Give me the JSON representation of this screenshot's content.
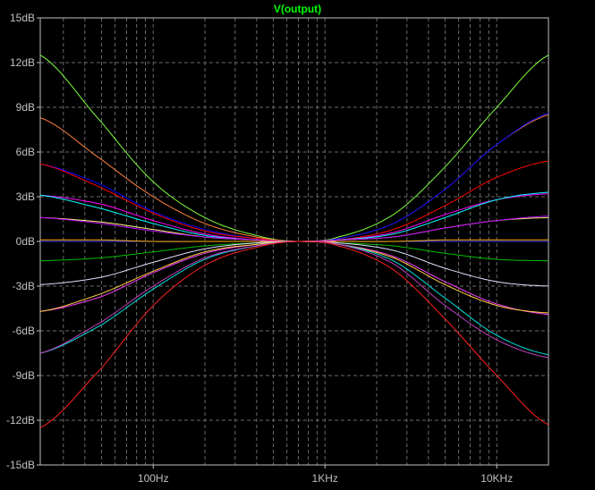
{
  "chart_data": {
    "type": "line",
    "title": "V(output)",
    "xlabel": "",
    "ylabel": "",
    "x_scale": "log",
    "xlim": [
      22,
      20000
    ],
    "ylim": [
      -15,
      15
    ],
    "grid": true,
    "y_ticks": [
      {
        "value": 15,
        "label": "15dB"
      },
      {
        "value": 12,
        "label": "12dB"
      },
      {
        "value": 9,
        "label": "9dB"
      },
      {
        "value": 6,
        "label": "6dB"
      },
      {
        "value": 3,
        "label": "3dB"
      },
      {
        "value": 0,
        "label": "0dB"
      },
      {
        "value": -3,
        "label": "-3dB"
      },
      {
        "value": -6,
        "label": "-6dB"
      },
      {
        "value": -9,
        "label": "-9dB"
      },
      {
        "value": -12,
        "label": "-12dB"
      },
      {
        "value": -15,
        "label": "-15dB"
      }
    ],
    "x_ticks": [
      {
        "value": 100,
        "label": "100Hz"
      },
      {
        "value": 1000,
        "label": "1KHz"
      },
      {
        "value": 10000,
        "label": "10KHz"
      }
    ],
    "series": [
      {
        "color": "#80ff40",
        "x": [
          22,
          50,
          100,
          200,
          400,
          700,
          1200,
          2500,
          5000,
          10000,
          20000
        ],
        "y": [
          12.5,
          8.0,
          4.0,
          1.6,
          0.4,
          0.0,
          0.3,
          1.8,
          5.0,
          9.0,
          12.5
        ]
      },
      {
        "color": "#ff8040",
        "x": [
          22,
          50,
          100,
          200,
          400,
          700,
          1200,
          2500,
          5000,
          10000,
          20000
        ],
        "y": [
          8.3,
          5.5,
          3.0,
          1.2,
          0.3,
          0.0,
          0.2,
          1.2,
          3.5,
          6.5,
          8.5
        ]
      },
      {
        "color": "#0000ff",
        "x": [
          22,
          50,
          100,
          200,
          400,
          700,
          1200,
          2500,
          5000,
          10000,
          20000
        ],
        "y": [
          5.2,
          3.8,
          2.0,
          0.8,
          0.2,
          0.0,
          0.2,
          1.2,
          3.5,
          6.5,
          8.6
        ]
      },
      {
        "color": "#ff0000",
        "x": [
          22,
          50,
          100,
          200,
          400,
          700,
          1200,
          2500,
          5000,
          10000,
          20000
        ],
        "y": [
          5.2,
          3.6,
          1.9,
          0.7,
          0.2,
          0.0,
          0.1,
          0.8,
          2.4,
          4.3,
          5.4
        ]
      },
      {
        "color": "#ff00ff",
        "x": [
          22,
          50,
          100,
          200,
          400,
          700,
          1200,
          2500,
          5000,
          10000,
          20000
        ],
        "y": [
          3.1,
          2.5,
          1.4,
          0.5,
          0.1,
          0.0,
          0.1,
          0.6,
          1.8,
          2.8,
          3.2
        ]
      },
      {
        "color": "#00ffff",
        "x": [
          22,
          50,
          100,
          200,
          400,
          700,
          1200,
          2500,
          5000,
          10000,
          20000
        ],
        "y": [
          3.1,
          2.2,
          1.2,
          0.4,
          0.1,
          0.0,
          0.1,
          0.5,
          1.6,
          2.8,
          3.3
        ]
      },
      {
        "color": "#ffff80",
        "x": [
          22,
          50,
          100,
          200,
          400,
          700,
          1200,
          2500,
          5000,
          10000,
          20000
        ],
        "y": [
          1.6,
          1.3,
          0.8,
          0.3,
          0.1,
          0.0,
          0.1,
          0.3,
          0.9,
          1.4,
          1.6
        ]
      },
      {
        "color": "#c000ff",
        "x": [
          22,
          50,
          100,
          200,
          400,
          700,
          1200,
          2500,
          5000,
          10000,
          20000
        ],
        "y": [
          1.6,
          1.2,
          0.7,
          0.3,
          0.1,
          0.0,
          0.1,
          0.3,
          0.9,
          1.4,
          1.7
        ]
      },
      {
        "color": "#4040ff",
        "x": [
          22,
          50,
          100,
          200,
          400,
          700,
          1200,
          2500,
          5000,
          10000,
          20000
        ],
        "y": [
          0.0,
          0.0,
          0.0,
          0.0,
          0.0,
          0.0,
          0.0,
          0.0,
          0.0,
          0.0,
          0.0
        ]
      },
      {
        "color": "#ffb000",
        "x": [
          22,
          50,
          100,
          200,
          400,
          700,
          1200,
          2500,
          5000,
          10000,
          20000
        ],
        "y": [
          0.1,
          0.1,
          0.0,
          0.0,
          0.0,
          0.0,
          0.0,
          0.0,
          0.1,
          0.1,
          0.1
        ]
      },
      {
        "color": "#00c000",
        "x": [
          22,
          50,
          100,
          200,
          400,
          700,
          1200,
          2500,
          5000,
          10000,
          20000
        ],
        "y": [
          -1.3,
          -1.1,
          -0.7,
          -0.3,
          -0.1,
          0.0,
          -0.1,
          -0.3,
          -0.8,
          -1.2,
          -1.3
        ]
      },
      {
        "color": "#e0e0ff",
        "x": [
          22,
          50,
          100,
          200,
          400,
          700,
          1200,
          2500,
          5000,
          10000,
          20000
        ],
        "y": [
          -2.9,
          -2.4,
          -1.4,
          -0.5,
          -0.1,
          0.0,
          -0.1,
          -0.6,
          -1.8,
          -2.7,
          -3.0
        ]
      },
      {
        "color": "#ff40ff",
        "x": [
          22,
          50,
          100,
          200,
          400,
          700,
          1200,
          2500,
          5000,
          10000,
          20000
        ],
        "y": [
          -4.7,
          -3.7,
          -2.1,
          -0.8,
          -0.2,
          0.0,
          -0.2,
          -1.0,
          -2.7,
          -4.2,
          -4.9
        ]
      },
      {
        "color": "#ffd040",
        "x": [
          22,
          50,
          100,
          200,
          400,
          700,
          1200,
          2500,
          5000,
          10000,
          20000
        ],
        "y": [
          -4.7,
          -3.5,
          -2.0,
          -0.7,
          -0.2,
          0.0,
          -0.2,
          -1.1,
          -2.9,
          -4.3,
          -4.8
        ]
      },
      {
        "color": "#00e0e0",
        "x": [
          22,
          50,
          100,
          200,
          400,
          700,
          1200,
          2500,
          5000,
          10000,
          20000
        ],
        "y": [
          -7.5,
          -5.6,
          -3.2,
          -1.2,
          -0.3,
          0.0,
          -0.2,
          -1.3,
          -3.8,
          -6.3,
          -7.6
        ]
      },
      {
        "color": "#c040c0",
        "x": [
          22,
          50,
          100,
          200,
          400,
          700,
          1200,
          2500,
          5000,
          10000,
          20000
        ],
        "y": [
          -7.5,
          -5.4,
          -3.0,
          -1.1,
          -0.3,
          0.0,
          -0.2,
          -1.5,
          -4.3,
          -6.6,
          -7.8
        ]
      },
      {
        "color": "#ff2020",
        "x": [
          22,
          50,
          100,
          200,
          400,
          700,
          1200,
          2500,
          5000,
          10000,
          20000
        ],
        "y": [
          -12.5,
          -8.5,
          -4.3,
          -1.6,
          -0.4,
          0.0,
          -0.3,
          -1.9,
          -5.2,
          -9.0,
          -12.3
        ]
      }
    ]
  }
}
